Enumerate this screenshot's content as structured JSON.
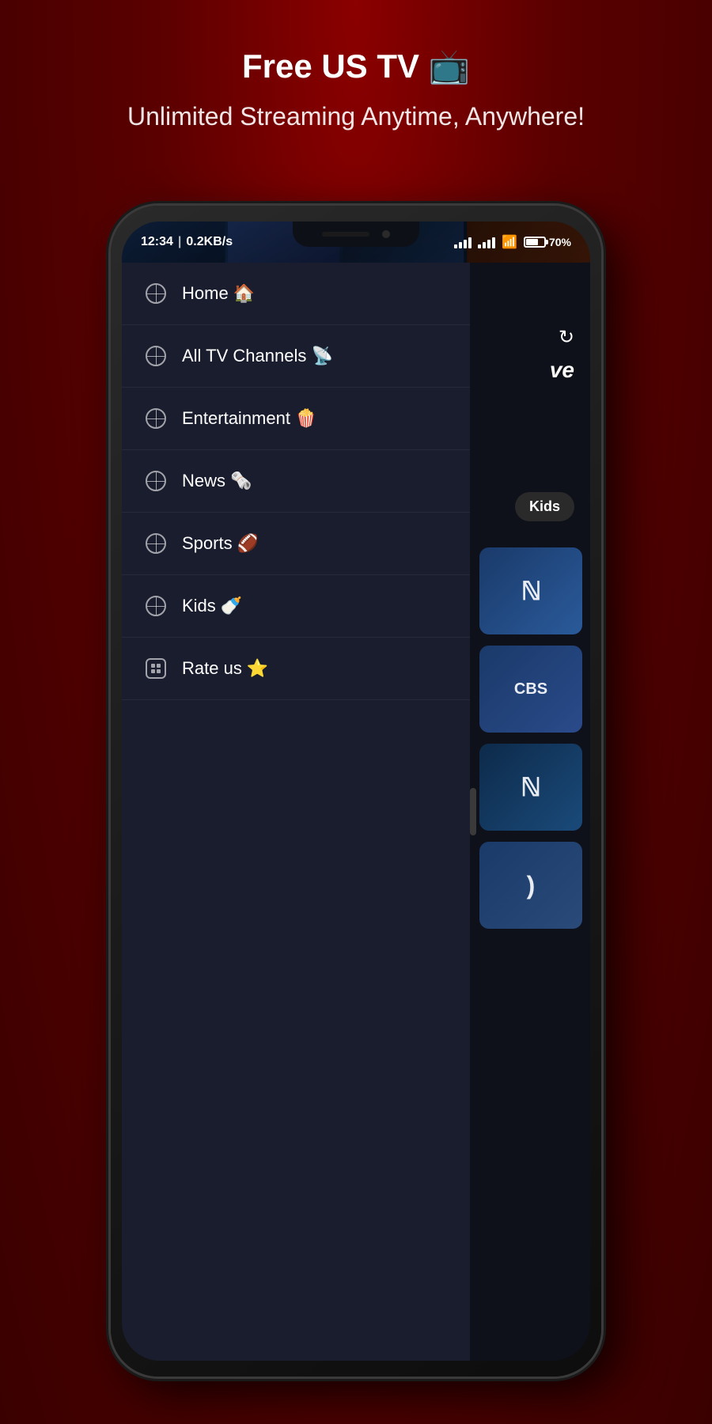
{
  "header": {
    "title": "Free US TV 📺",
    "subtitle": "Unlimited Streaming Anytime, Anywhere!"
  },
  "statusBar": {
    "time": "12:34",
    "speed": "0.2KB/s",
    "battery": "70%"
  },
  "rightPanel": {
    "liveText": "ve",
    "kidsTab": "Kids"
  },
  "refreshButton": "↻",
  "sideHandle": "",
  "menuItems": [
    {
      "id": "home",
      "icon": "globe",
      "label": "Home 🏠",
      "iconType": "globe"
    },
    {
      "id": "all-tv-channels",
      "icon": "globe",
      "label": "All TV Channels 📡",
      "iconType": "globe"
    },
    {
      "id": "entertainment",
      "icon": "globe",
      "label": "Entertainment 🍿",
      "iconType": "globe"
    },
    {
      "id": "news",
      "icon": "globe",
      "label": "News 🗞️",
      "iconType": "globe"
    },
    {
      "id": "sports",
      "icon": "globe",
      "label": "Sports 🏈",
      "iconType": "globe"
    },
    {
      "id": "kids",
      "icon": "globe",
      "label": "Kids 🍼",
      "iconType": "globe"
    },
    {
      "id": "rate-us",
      "icon": "app",
      "label": "Rate us ⭐",
      "iconType": "app"
    }
  ],
  "channels": [
    {
      "logo": "N",
      "index": 0
    },
    {
      "logo": "CBS",
      "index": 1
    },
    {
      "logo": "N",
      "index": 2
    },
    {
      "logo": ")",
      "index": 3
    }
  ]
}
